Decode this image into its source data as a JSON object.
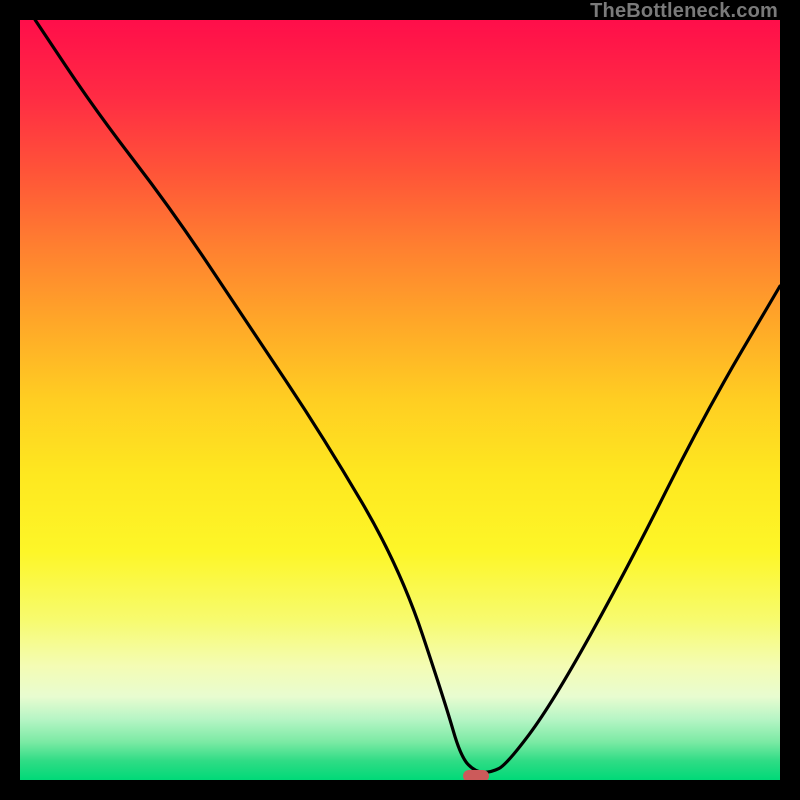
{
  "attribution": "TheBottleneck.com",
  "colors": {
    "background": "#000000",
    "attribution_text": "#7a7a7a",
    "curve": "#000000",
    "marker_fill": "#cc5a5a",
    "gradient_top": "#ff0e4a",
    "gradient_bottom": "#00d978"
  },
  "chart_data": {
    "type": "line",
    "title": "",
    "xlabel": "",
    "ylabel": "",
    "xlim": [
      0,
      100
    ],
    "ylim": [
      0,
      100
    ],
    "grid": false,
    "legend": false,
    "note": "x and y are percent of plot area width/height; y measured from bottom",
    "series": [
      {
        "name": "bottleneck-curve",
        "x": [
          2,
          10,
          20,
          30,
          40,
          50,
          56,
          58,
          60,
          62,
          64,
          70,
          80,
          90,
          100
        ],
        "y": [
          100,
          88,
          75,
          60,
          45,
          28,
          10,
          3,
          1,
          1,
          2,
          10,
          28,
          48,
          65
        ]
      }
    ],
    "marker": {
      "name": "optimum-marker",
      "x": 60,
      "y": 0.5,
      "color": "#cc5a5a",
      "shape": "pill"
    },
    "background_gradient": {
      "direction": "vertical",
      "stops": [
        {
          "pos": 0.0,
          "color": "#ff0e4a"
        },
        {
          "pos": 0.1,
          "color": "#ff2b44"
        },
        {
          "pos": 0.2,
          "color": "#ff5438"
        },
        {
          "pos": 0.3,
          "color": "#ff8030"
        },
        {
          "pos": 0.4,
          "color": "#ffa828"
        },
        {
          "pos": 0.5,
          "color": "#ffce22"
        },
        {
          "pos": 0.6,
          "color": "#fee820"
        },
        {
          "pos": 0.7,
          "color": "#fdf628"
        },
        {
          "pos": 0.79,
          "color": "#f7fb6f"
        },
        {
          "pos": 0.85,
          "color": "#f4fcb4"
        },
        {
          "pos": 0.89,
          "color": "#e8fcd0"
        },
        {
          "pos": 0.92,
          "color": "#b6f5c5"
        },
        {
          "pos": 0.95,
          "color": "#7beaa4"
        },
        {
          "pos": 0.975,
          "color": "#2fdc85"
        },
        {
          "pos": 1.0,
          "color": "#00d978"
        }
      ]
    }
  }
}
